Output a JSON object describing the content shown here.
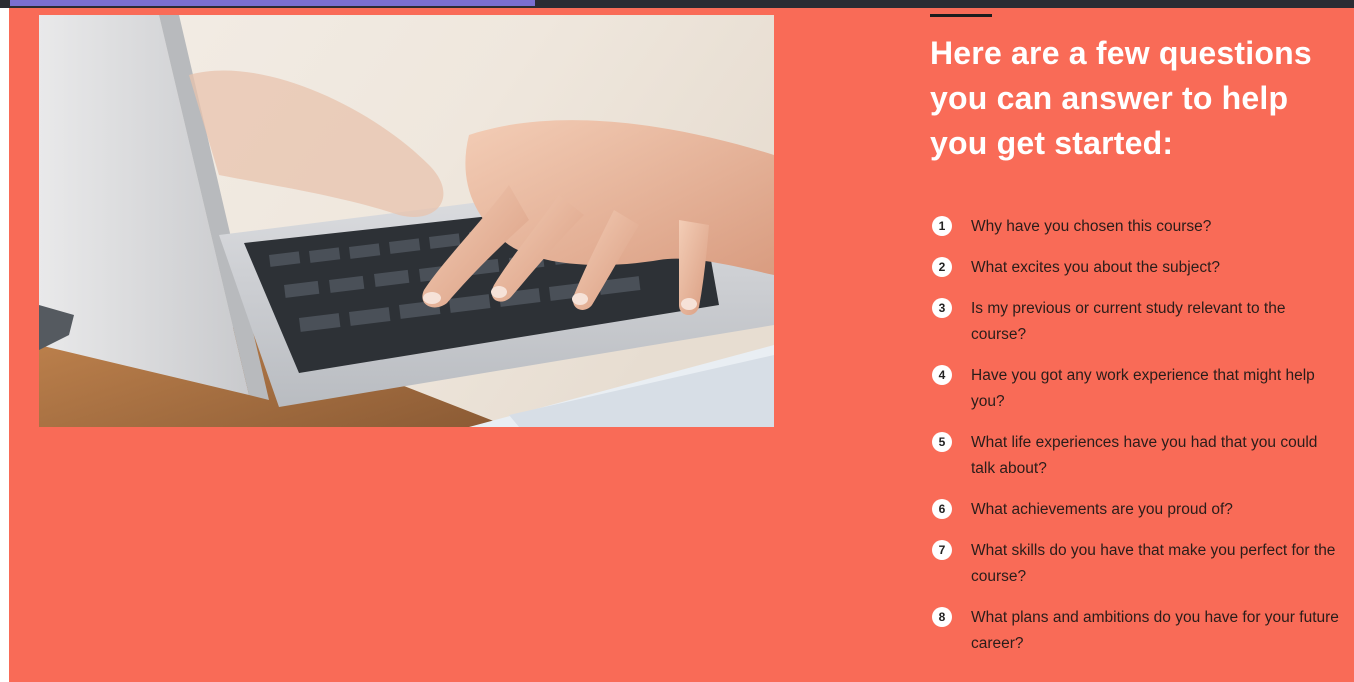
{
  "heading": "Here are a few questions you can answer to help you get started:",
  "hero_image": {
    "subject": "hands typing on a laptop keyboard"
  },
  "questions": [
    {
      "num": "1",
      "text": "Why have you chosen this course?"
    },
    {
      "num": "2",
      "text": "What excites you about the subject?"
    },
    {
      "num": "3",
      "text": "Is my previous or current study relevant to the course?"
    },
    {
      "num": "4",
      "text": "Have you got any work experience that might help you?"
    },
    {
      "num": "5",
      "text": "What life experiences have you had that you could talk about?"
    },
    {
      "num": "6",
      "text": "What achievements are you proud of?"
    },
    {
      "num": "7",
      "text": "What skills do you have that make you perfect for the course?"
    },
    {
      "num": "8",
      "text": "What plans and ambitions do you have for your future career?"
    }
  ],
  "colors": {
    "background": "#f96b57",
    "heading": "#ffffff",
    "accent_line": "#1d1d1d",
    "body_text": "#2a1d1a"
  }
}
